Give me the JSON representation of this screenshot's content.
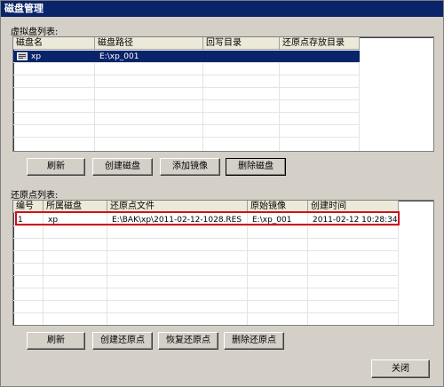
{
  "window": {
    "title": "磁盘管理"
  },
  "vdisk_section": {
    "label": "虚拟盘列表:",
    "columns": [
      "磁盘名",
      "磁盘路径",
      "回写目录",
      "还原点存放目录"
    ],
    "rows": [
      {
        "name": "xp",
        "path": "E:\\xp_001",
        "writeback": "",
        "restore_dir": ""
      }
    ],
    "selected_row": 0
  },
  "vdisk_buttons": {
    "refresh": "刷新",
    "create": "创建磁盘",
    "add_image": "添加镜像",
    "delete": "删除磁盘"
  },
  "restore_section": {
    "label": "还原点列表:",
    "columns": [
      "编号",
      "所属磁盘",
      "还原点文件",
      "原始镜像",
      "创建时间"
    ],
    "rows": [
      {
        "id": "1",
        "disk": "xp",
        "file": "E:\\BAK\\xp\\2011-02-12-1028.RES",
        "image": "E:\\xp_001",
        "created": "2011-02-12 10:28:34"
      }
    ],
    "highlight_color": "#d0101a"
  },
  "restore_buttons": {
    "refresh": "刷新",
    "create": "创建还原点",
    "restore": "恢复还原点",
    "delete": "删除还原点"
  },
  "footer": {
    "close": "关闭"
  }
}
